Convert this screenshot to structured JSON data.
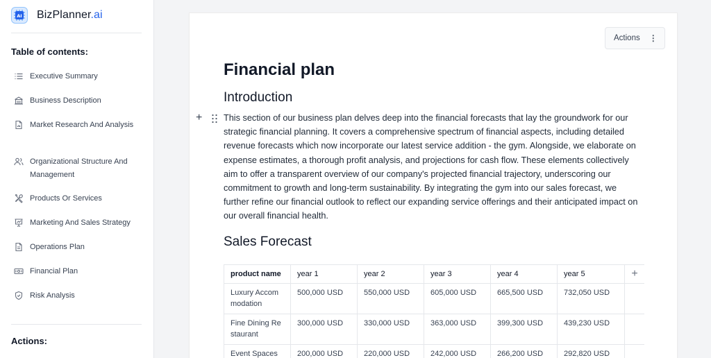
{
  "sidebar": {
    "brand": {
      "name": "BizPlanner",
      "suffix": ".ai",
      "logo_text": "AI"
    },
    "toc_title": "Table of contents:",
    "toc_items": [
      {
        "label": "Executive Summary",
        "icon": "list-icon"
      },
      {
        "label": "Business Description",
        "icon": "building-icon"
      },
      {
        "label": "Market Research And Analysis",
        "icon": "document-chart-icon"
      },
      {
        "label": "Organizational Structure And Management",
        "icon": "users-icon"
      },
      {
        "label": "Products Or Services",
        "icon": "tools-icon"
      },
      {
        "label": "Marketing And Sales Strategy",
        "icon": "presentation-icon"
      },
      {
        "label": "Operations Plan",
        "icon": "document-icon"
      },
      {
        "label": "Financial Plan",
        "icon": "banknote-icon"
      },
      {
        "label": "Risk Analysis",
        "icon": "shield-icon"
      }
    ],
    "actions_title": "Actions:"
  },
  "main": {
    "actions_label": "Actions",
    "title": "Financial plan",
    "intro_heading": "Introduction",
    "intro_text": "This section of our business plan delves deep into the financial forecasts that lay the groundwork for our strategic financial planning. It covers a comprehensive spectrum of financial aspects, including detailed revenue forecasts which now incorporate our latest service addition - the gym. Alongside, we elaborate on expense estimates, a thorough profit analysis, and projections for cash flow. These elements collectively aim to offer a transparent overview of our company's projected financial trajectory, underscoring our commitment to growth and long-term sustainability. By integrating the gym into our sales forecast, we further refine our financial outlook to reflect our expanding service offerings and their anticipated impact on our overall financial health.",
    "sales_heading": "Sales Forecast",
    "table": {
      "headers": [
        "product name",
        "year 1",
        "year 2",
        "year 3",
        "year 4",
        "year 5"
      ],
      "rows": [
        [
          "Luxury Accommodation",
          "500,000 USD",
          "550,000 USD",
          "605,000 USD",
          "665,500 USD",
          "732,050 USD"
        ],
        [
          "Fine Dining Restaurant",
          "300,000 USD",
          "330,000 USD",
          "363,000 USD",
          "399,300 USD",
          "439,230 USD"
        ],
        [
          "Event Spaces",
          "200,000 USD",
          "220,000 USD",
          "242,000 USD",
          "266,200 USD",
          "292,820 USD"
        ]
      ]
    }
  }
}
